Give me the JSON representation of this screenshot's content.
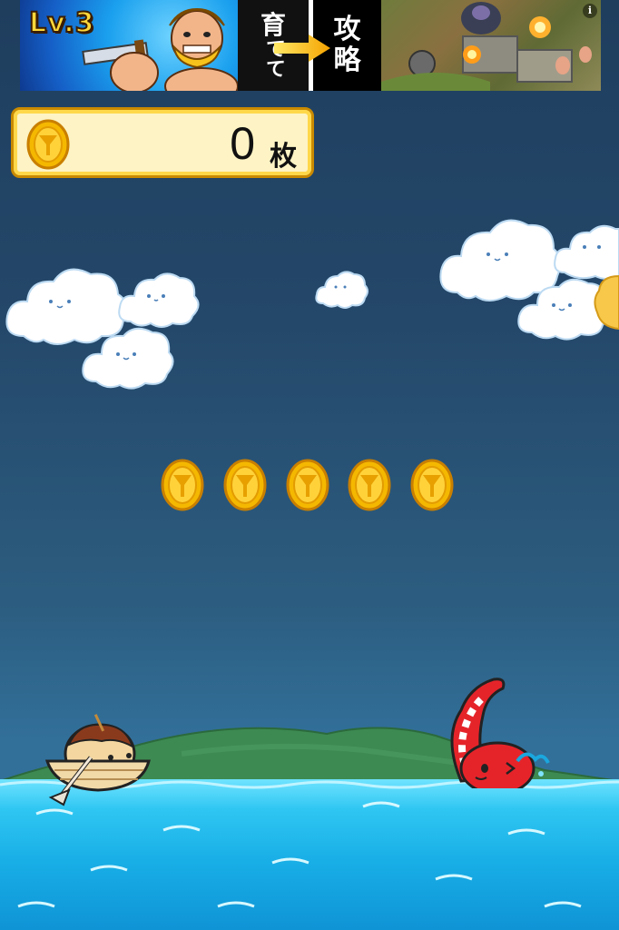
{
  "ad": {
    "level_badge": "Lv.3",
    "grow_text_top": "育",
    "grow_text_bottom": "てて",
    "conquer_text_top": "攻",
    "conquer_text_bottom": "略",
    "info_icon": "i"
  },
  "hud": {
    "coin_count": "0",
    "coin_unit": "枚",
    "coin_icon": "coin-icon"
  },
  "scene": {
    "coins_in_row": 5,
    "clouds": 7,
    "characters": [
      "takoyaki-on-boat",
      "octopus-tentacle"
    ],
    "colors": {
      "sky_top": "#1f3e5e",
      "sky_bottom": "#32709a",
      "sea": "#18aee6",
      "hill": "#3d8a52",
      "coin": "#f5b800",
      "octopus": "#e5242a"
    }
  }
}
